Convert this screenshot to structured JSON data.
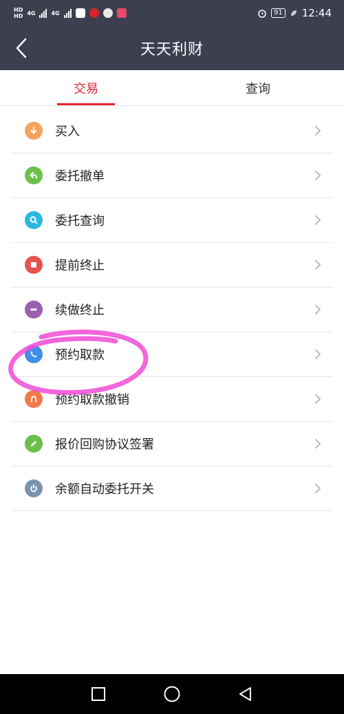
{
  "status_bar": {
    "hd1": "HD",
    "hd2": "HD",
    "net1": "4G",
    "net2": "4G",
    "battery": "91",
    "time": "12:44"
  },
  "header": {
    "title": "天天利财"
  },
  "tabs": [
    {
      "label": "交易",
      "active": true
    },
    {
      "label": "查询",
      "active": false
    }
  ],
  "menu": [
    {
      "label": "买入",
      "icon": "arrow-down-icon",
      "color": "#f5a25d"
    },
    {
      "label": "委托撤单",
      "icon": "undo-arrow-icon",
      "color": "#6cc04a"
    },
    {
      "label": "委托查询",
      "icon": "search-icon",
      "color": "#2bb8e0"
    },
    {
      "label": "提前终止",
      "icon": "stop-icon",
      "color": "#e4534f"
    },
    {
      "label": "续做终止",
      "icon": "minus-icon",
      "color": "#9a5fb0"
    },
    {
      "label": "预约取款",
      "icon": "phone-icon",
      "color": "#3f8fe4"
    },
    {
      "label": "预约取款撤销",
      "icon": "u-turn-icon",
      "color": "#f07a4a"
    },
    {
      "label": "报价回购协议签署",
      "icon": "pencil-icon",
      "color": "#6cc04a"
    },
    {
      "label": "余额自动委托开关",
      "icon": "power-icon",
      "color": "#7a93ad"
    }
  ],
  "colors": {
    "header_bg": "#3b3f4f",
    "accent": "#e0282e",
    "highlight": "#f04bd6"
  }
}
